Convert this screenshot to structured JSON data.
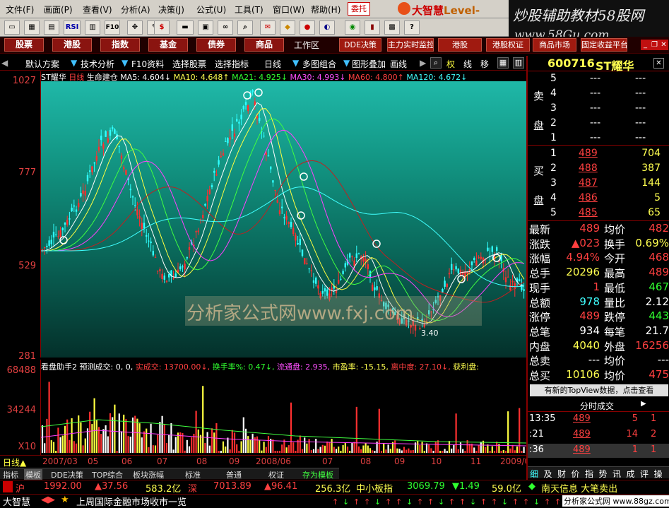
{
  "menu": [
    "文件(F)",
    "画面(P)",
    "查看(V)",
    "分析(A)",
    "决策(J)",
    "公式(U)",
    "工具(T)",
    "窗口(W)",
    "帮助(H)"
  ],
  "delegate_label": "委托",
  "brand": "大智慧",
  "brand_suffix": "Level-",
  "corner_title": "炒股辅助教材58股网",
  "corner_url": "www.58Gu.com",
  "toolbar_icons": [
    "open-icon",
    "chart-icon",
    "table-icon",
    "rsi-icon",
    "k-icon",
    "f10-icon",
    "draw-icon",
    "ruler-icon",
    "dollar-icon",
    "flag-icon",
    "card-icon",
    "binoculars-icon",
    "search-icon",
    "sms-icon",
    "diamond-icon",
    "eraser-icon",
    "toggle-icon",
    "globe-icon",
    "book-icon",
    "grid-icon",
    "help-icon"
  ],
  "toolbar_labels": {
    "rsi": "RSI",
    "f10": "F10",
    "dollar": "$"
  },
  "market_tabs": [
    "股票",
    "港股",
    "指数",
    "基金",
    "债券",
    "商品"
  ],
  "work_area": "工作区",
  "quick_tabs": [
    "DDE决策",
    "主力实时监控",
    "港股",
    "港股权证",
    "商品市场",
    "固定收益平台"
  ],
  "subbar": {
    "default_scheme": "默认方案",
    "tech_analysis": "技术分析",
    "f10": "F10资料",
    "select_stock": "选择股票",
    "select_indicator": "选择指标",
    "period": "日线",
    "multi_chart": "多图组合",
    "overlay": "图形叠加",
    "qu": "画线",
    "right_weight": "权",
    "line": "线",
    "move": "移"
  },
  "chart_title": {
    "stock": "ST耀华",
    "period": "日线",
    "indicator": "生命建仓",
    "ma5": "MA5: 4.604↓",
    "ma10": "MA10: 4.648↑",
    "ma21": "MA21: 4.925↓",
    "ma30": "MA30: 4.993↓",
    "ma60": "MA60: 4.800↑",
    "ma120": "MA120: 4.672↓"
  },
  "y_ticks": [
    "1027",
    "777",
    "529",
    "281"
  ],
  "vol_ticks": [
    "68488",
    "34244",
    "X10"
  ],
  "low_mark": "3.40",
  "watermark": "分析家公式网www.fxj.com",
  "vol_header": {
    "helper": "看盘助手2",
    "forecast": "预测成交: 0, 0,",
    "actual": "实成交: 13700.00↓,",
    "turnover": "换手率%: 0.47↓,",
    "float": "流通盘: 2.935,",
    "pe": "市盈率: -15.15,",
    "center": "离中度: 27.10↓,",
    "profit": "获利盘:"
  },
  "date_labels": [
    "日线▲",
    "2007/03",
    "05",
    "06",
    "07",
    "08",
    "09",
    "2008/06",
    "07",
    "08",
    "09",
    "10",
    "11",
    "2009/01"
  ],
  "period_tabs": [
    "指标",
    "模板",
    "DDE决策",
    "TOP综合",
    "板块涨幅",
    "标准",
    "普通",
    "权证",
    "存为模板"
  ],
  "status1": {
    "sh_label": "沪",
    "sh_index": "1992.00",
    "sh_change": "▲37.56",
    "sh_amount": "583.2亿",
    "sz_label": "深",
    "sz_index": "7013.89",
    "sz_change": "▲96.41",
    "sz_amount": "256.3亿",
    "sme_label": "中小板指",
    "sme_index": "3069.79",
    "sme_change": "▼1.49",
    "sme_amount": "59.0亿",
    "news": "南天信息 大笔卖出"
  },
  "status2": {
    "app": "大智慧",
    "ticker_news": "上周国际金融市场收市一览",
    "site": "分析家公式网 www.88gz.com"
  },
  "stock": {
    "code": "600716",
    "name": "ST耀华"
  },
  "sell_label": [
    "卖",
    "盘"
  ],
  "buy_label": [
    "买",
    "盘"
  ],
  "sell_rows": [
    {
      "n": "5",
      "price": "---",
      "vol": "---"
    },
    {
      "n": "4",
      "price": "---",
      "vol": "---"
    },
    {
      "n": "3",
      "price": "---",
      "vol": "---"
    },
    {
      "n": "2",
      "price": "---",
      "vol": "---"
    },
    {
      "n": "1",
      "price": "---",
      "vol": "---"
    }
  ],
  "buy_rows": [
    {
      "n": "1",
      "price": "489",
      "vol": "704"
    },
    {
      "n": "2",
      "price": "488",
      "vol": "387"
    },
    {
      "n": "3",
      "price": "487",
      "vol": "144"
    },
    {
      "n": "4",
      "price": "486",
      "vol": "5"
    },
    {
      "n": "5",
      "price": "485",
      "vol": "65"
    }
  ],
  "quote_rows": [
    {
      "l1": "最新",
      "v1": "489",
      "l2": "均价",
      "v2": "482"
    },
    {
      "l1": "涨跌",
      "v1": "▲023",
      "l2": "换手",
      "v2": "0.69%"
    },
    {
      "l1": "涨幅",
      "v1": "4.94%",
      "l2": "今开",
      "v2": "468"
    },
    {
      "l1": "总手",
      "v1": "20296",
      "l2": "最高",
      "v2": "489"
    },
    {
      "l1": "现手",
      "v1": "1",
      "l2": "最低",
      "v2": "467"
    },
    {
      "l1": "总额",
      "v1": "978",
      "l2": "量比",
      "v2": "2.12"
    },
    {
      "l1": "涨停",
      "v1": "489",
      "l2": "跌停",
      "v2": "443"
    },
    {
      "l1": "总笔",
      "v1": "934",
      "l2": "每笔",
      "v2": "21.7"
    },
    {
      "l1": "内盘",
      "v1": "4040",
      "l2": "外盘",
      "v2": "16256"
    },
    {
      "l1": "总卖",
      "v1": "---",
      "l2": "均价",
      "v2": "---"
    },
    {
      "l1": "总买",
      "v1": "10106",
      "l2": "均价",
      "v2": "475"
    }
  ],
  "topview": "有新的TopView数据，点击查看",
  "tick_header": "分时成交",
  "ticks": [
    {
      "t": "13:35",
      "p": "489",
      "v": "5",
      "n": "1"
    },
    {
      "t": ":21",
      "p": "489",
      "v": "14",
      "n": "2"
    },
    {
      "t": ":36",
      "p": "489",
      "v": "1",
      "n": "1"
    }
  ],
  "right_tabs": [
    "细",
    "及",
    "财",
    "价",
    "指",
    "势",
    "讯",
    "成",
    "评",
    "操"
  ],
  "colors": {
    "up": "#ff4040",
    "down": "#40ffff",
    "accent": "#8a1410",
    "panel_bg": "#000000"
  }
}
